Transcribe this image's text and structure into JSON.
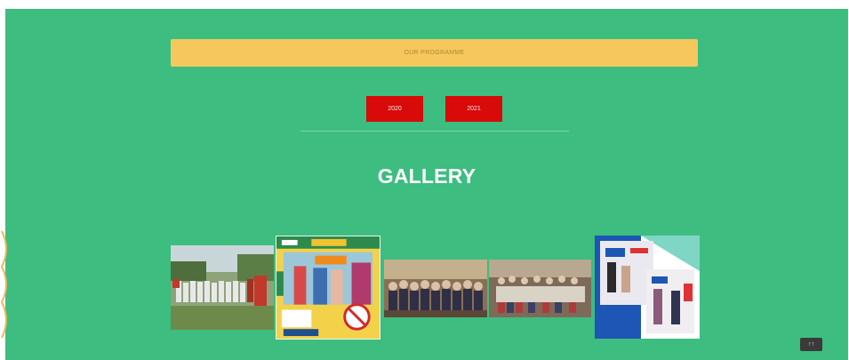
{
  "programme_bar": {
    "label": "OUR PROGRAMME"
  },
  "year_tabs": [
    {
      "label": "2020"
    },
    {
      "label": "2021"
    }
  ],
  "gallery": {
    "title": "GALLERY",
    "photos": [
      {
        "name": "group-outdoor-photo"
      },
      {
        "name": "poster-photo"
      },
      {
        "name": "group-indoor-photo"
      },
      {
        "name": "conference-room-photo"
      },
      {
        "name": "presentation-collage-photo"
      }
    ]
  },
  "corner_button": {
    "label": "↑↑"
  },
  "colors": {
    "background": "#3dbd7f",
    "programme_bar": "#f5c75d",
    "year_button": "#d90a0a",
    "title_text": "#ffffff"
  }
}
